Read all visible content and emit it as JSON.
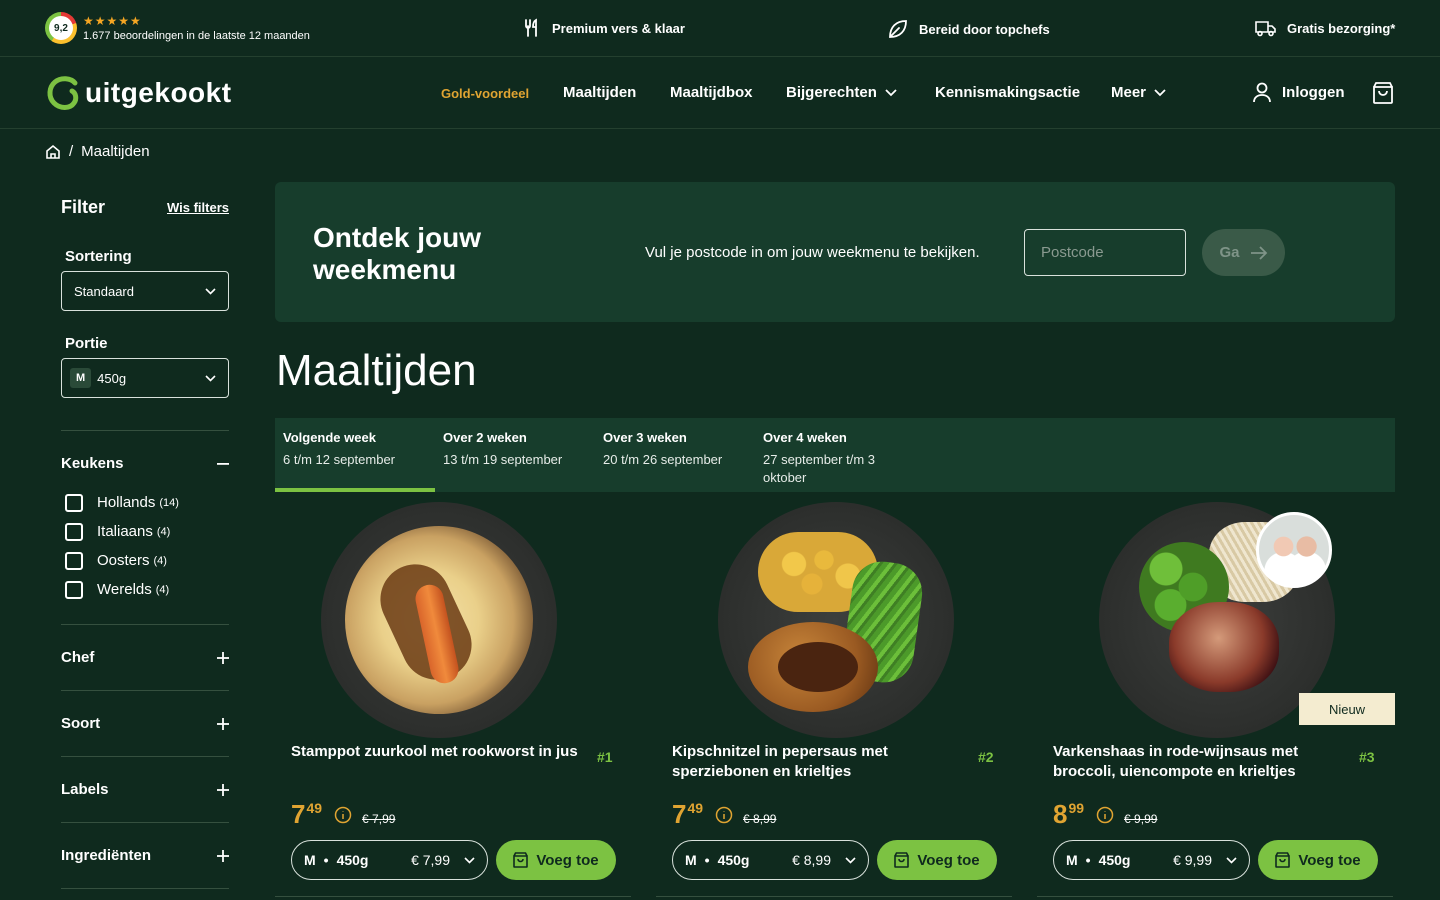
{
  "topbar": {
    "rating_score": "9,2",
    "rating_stars": "★★★★★",
    "rating_count": "1.677 beoordelingen in de laatste 12 maanden",
    "usps": [
      {
        "label": "Premium vers & klaar",
        "icon": "cutlery-icon"
      },
      {
        "label": "Bereid door topchefs",
        "icon": "leaf-icon"
      },
      {
        "label": "Gratis bezorging*",
        "icon": "truck-icon"
      }
    ]
  },
  "nav": {
    "logo": "uitgekookt",
    "items": [
      {
        "label": "Gold-voordeel",
        "highlight": true
      },
      {
        "label": "Maaltijden"
      },
      {
        "label": "Maaltijdbox"
      },
      {
        "label": "Bijgerechten",
        "dropdown": true
      },
      {
        "label": "Kennismakingsactie"
      },
      {
        "label": "Meer",
        "dropdown": true
      }
    ],
    "login": "Inloggen"
  },
  "breadcrumb": {
    "current": "Maaltijden"
  },
  "filters": {
    "title": "Filter",
    "clear": "Wis filters",
    "sort_label": "Sortering",
    "sort_value": "Standaard",
    "portion_label": "Portie",
    "portion_size": "M",
    "portion_value": "450g",
    "kitchens": {
      "title": "Keukens",
      "options": [
        {
          "label": "Hollands",
          "count": "(14)"
        },
        {
          "label": "Italiaans",
          "count": "(4)"
        },
        {
          "label": "Oosters",
          "count": "(4)"
        },
        {
          "label": "Werelds",
          "count": "(4)"
        }
      ]
    },
    "sections": [
      "Chef",
      "Soort",
      "Labels",
      "Ingrediënten"
    ]
  },
  "hero": {
    "title": "Ontdek jouw weekmenu",
    "text": "Vul je postcode in om jouw weekmenu te bekijken.",
    "placeholder": "Postcode",
    "button": "Ga"
  },
  "page_title": "Maaltijden",
  "weeks": [
    {
      "title": "Volgende week",
      "dates": "6 t/m 12 september"
    },
    {
      "title": "Over 2 weken",
      "dates": "13 t/m 19 september"
    },
    {
      "title": "Over 3 weken",
      "dates": "20 t/m 26 september"
    },
    {
      "title": "Over 4 weken",
      "dates": "27 september t/m 3 oktober"
    }
  ],
  "products": [
    {
      "name": "Stamppot zuurkool met rookworst in jus",
      "rank": "#1",
      "price_int": "7",
      "price_dec": "49",
      "old_price": "€ 7,99",
      "size": "M",
      "weight": "450g",
      "variant_price": "€ 7,99",
      "cta": "Voeg toe"
    },
    {
      "name": "Kipschnitzel in pepersaus met sperziebonen en krieltjes",
      "rank": "#2",
      "price_int": "7",
      "price_dec": "49",
      "old_price": "€ 8,99",
      "size": "M",
      "weight": "450g",
      "variant_price": "€ 8,99",
      "cta": "Voeg toe"
    },
    {
      "name": "Varkenshaas in rode-wijnsaus met broccoli, uiencompote en krieltjes",
      "rank": "#3",
      "price_int": "8",
      "price_dec": "99",
      "old_price": "€ 9,99",
      "size": "M",
      "weight": "450g",
      "variant_price": "€ 9,99",
      "cta": "Voeg toe",
      "badge": "Nieuw"
    }
  ],
  "colors": {
    "background": "#0f2a1e",
    "panel": "#173d2c",
    "accent_green": "#7cc242",
    "accent_gold": "#e0a432"
  }
}
